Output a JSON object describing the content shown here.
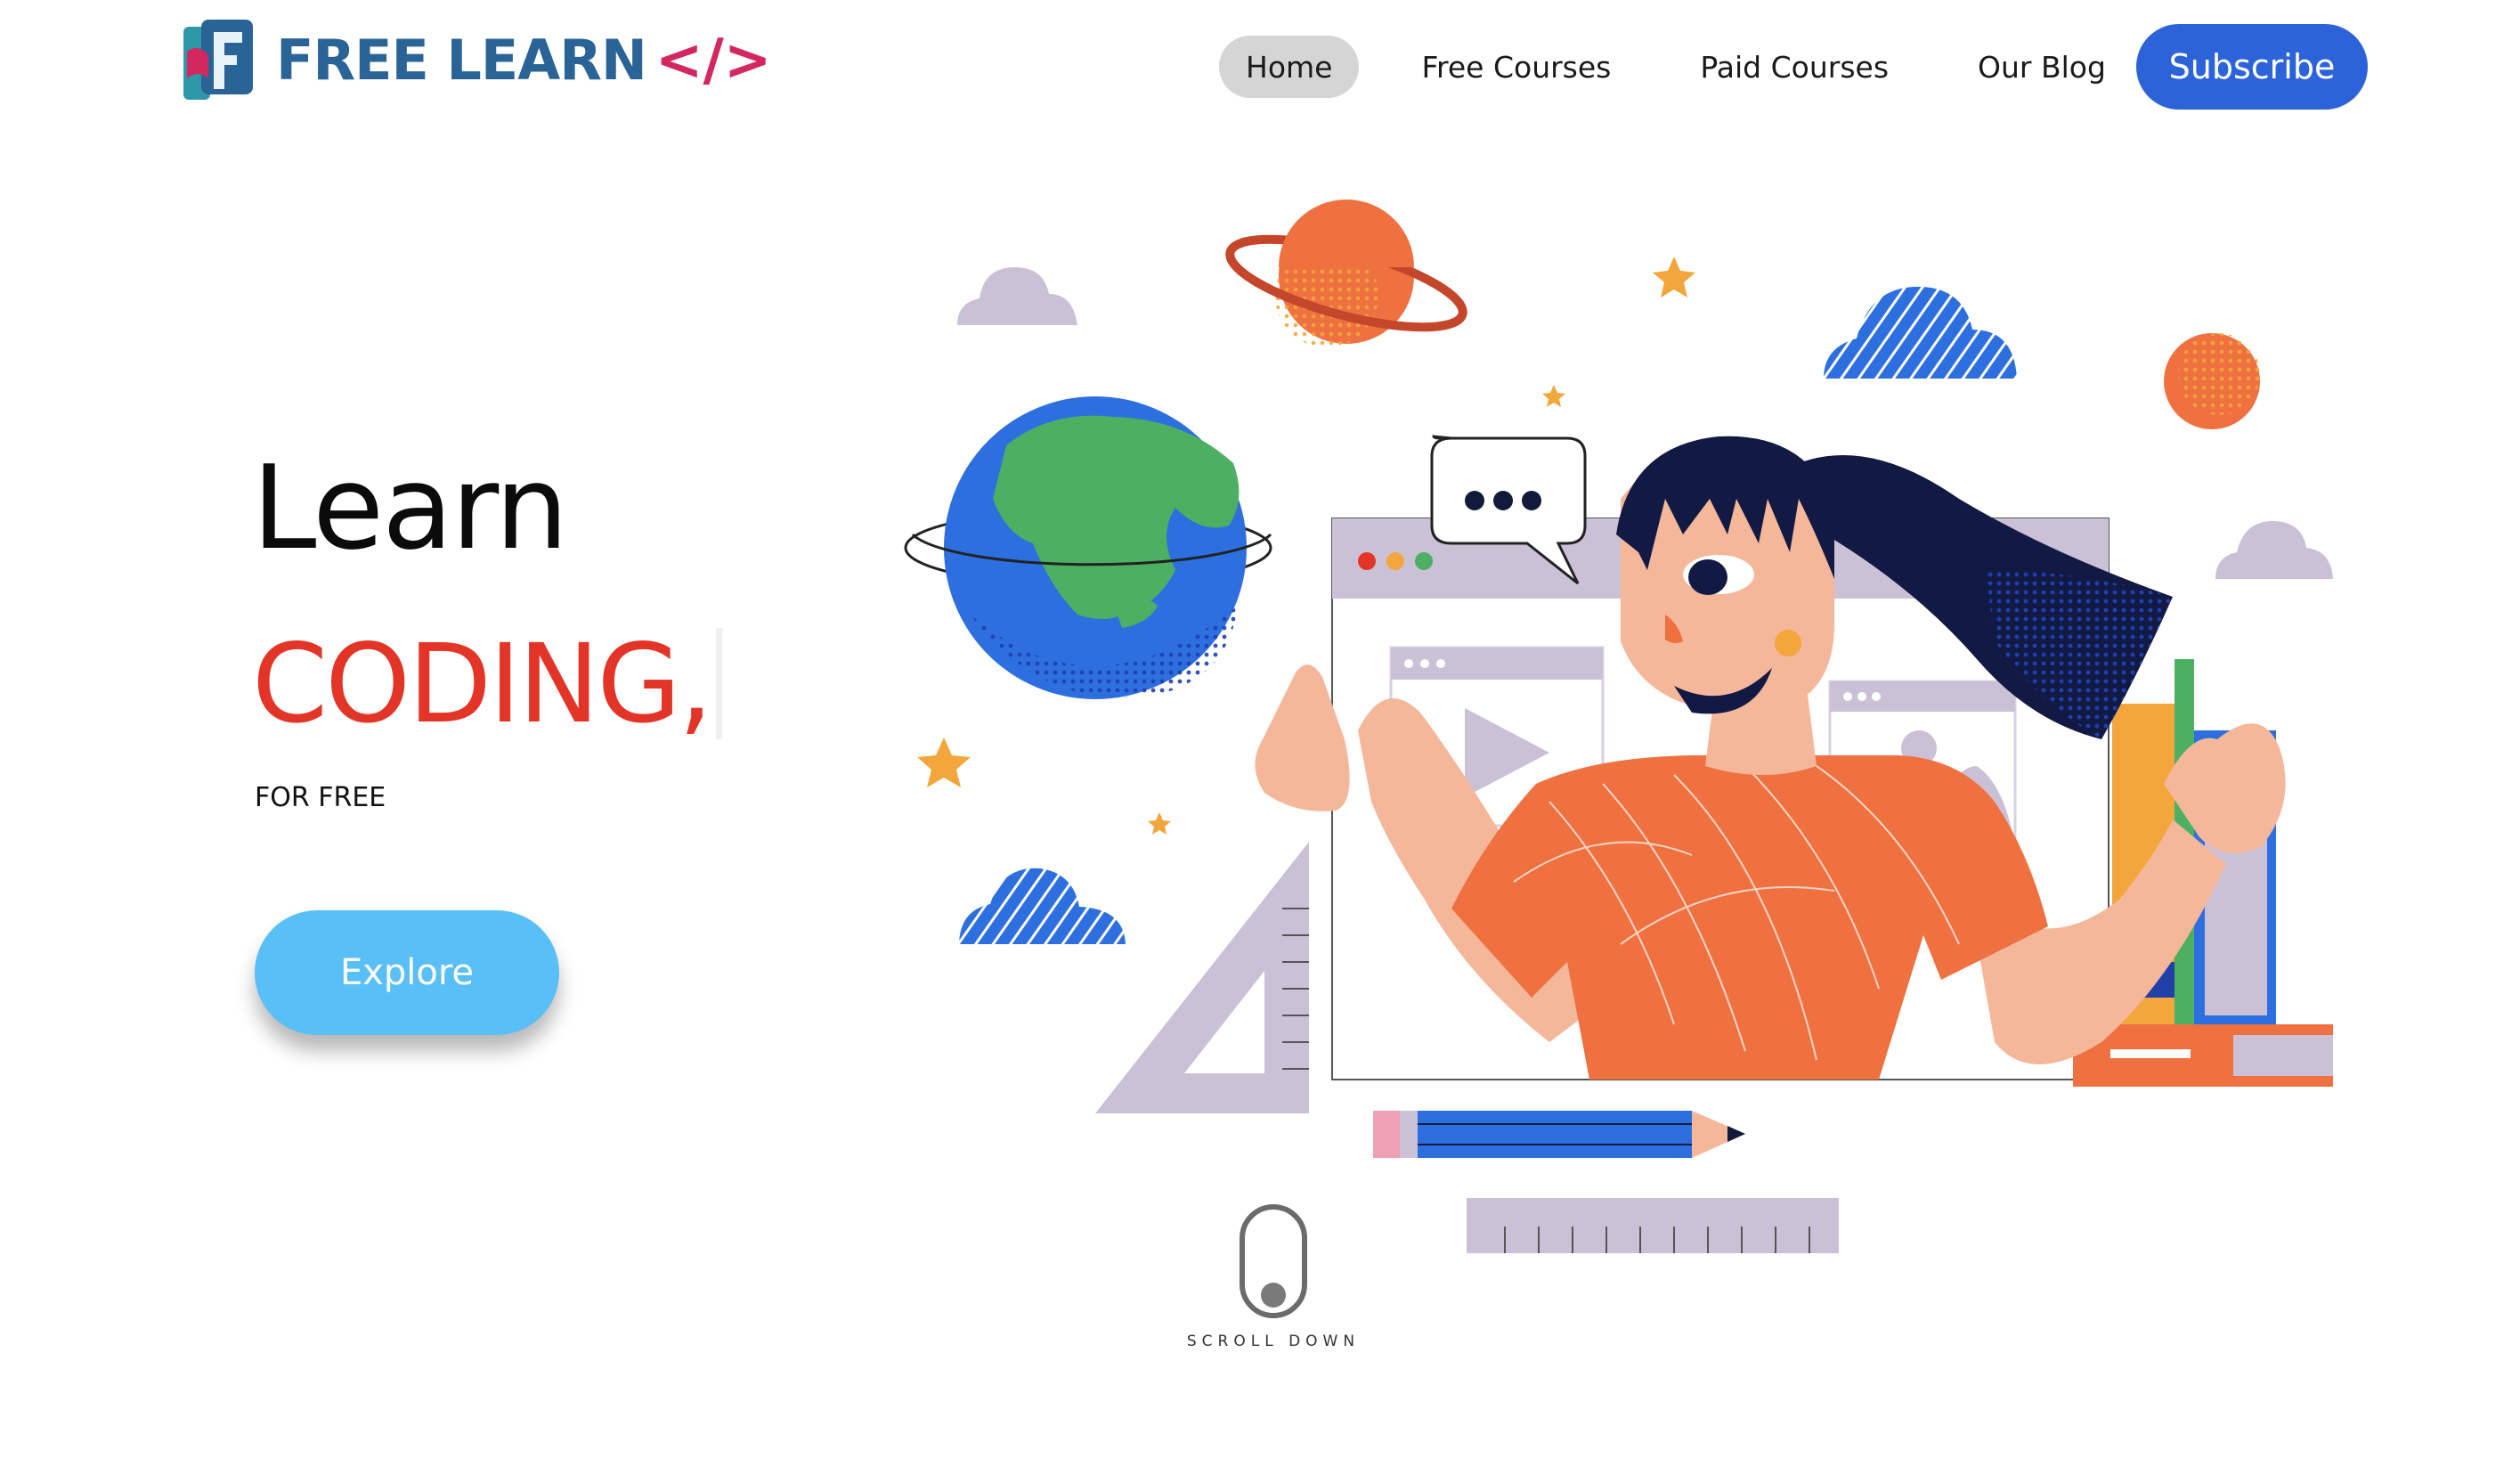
{
  "header": {
    "logo_text": "FREE LEARN",
    "logo_code": "</>",
    "nav": [
      "Home",
      "Free Courses",
      "Paid Courses",
      "Our Blog"
    ],
    "active_nav": "Home",
    "subscribe_label": "Subscribe"
  },
  "hero": {
    "line1": "Learn",
    "line2": "CODING,",
    "subtitle": "FOR FREE",
    "explore_label": "Explore"
  },
  "scroll": {
    "label": "SCROLL DOWN"
  },
  "colors": {
    "brand_blue": "#2a6396",
    "brand_pink": "#d3275f",
    "accent_red": "#e23527",
    "subscribe_blue": "#2d63d9",
    "explore_blue": "#58bff7",
    "orange": "#ef7140",
    "lavender": "#cbc1d6",
    "cloud_blue": "#2e6fe0",
    "star": "#f2a63b"
  },
  "icons": {
    "logo": "free-learn-logo-icon",
    "mouse": "mouse-scroll-icon",
    "chat": "speech-bubble-icon",
    "play": "play-icon"
  }
}
